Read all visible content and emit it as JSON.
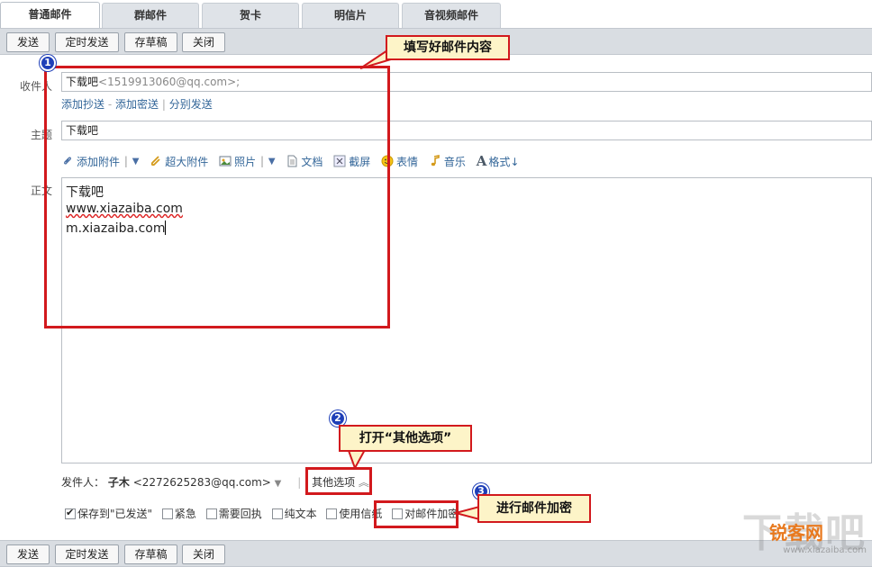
{
  "tabs": [
    "普通邮件",
    "群邮件",
    "贺卡",
    "明信片",
    "音视频邮件"
  ],
  "toolbar": {
    "send": "发送",
    "scheduled": "定时发送",
    "draft": "存草稿",
    "close": "关闭"
  },
  "form": {
    "to_label": "收件人",
    "to_name": "下载吧",
    "to_email": "<1519913060@qq.com>;",
    "cc": "添加抄送",
    "sep1": "-",
    "bcc": "添加密送",
    "sep2": "|",
    "separate": "分别发送",
    "subject_label": "主题",
    "subject": "下载吧",
    "body_label": "正文"
  },
  "attach": {
    "attachment": "添加附件",
    "big_attachment": "超大附件",
    "photo": "照片",
    "document": "文档",
    "screenshot": "截屏",
    "emoji": "表情",
    "music": "音乐",
    "format": "格式↓"
  },
  "body_lines": [
    "下载吧",
    "www.xiazaiba.com",
    "m.xiazaiba.com"
  ],
  "sender": {
    "label": "发件人：",
    "name": "子木",
    "email": "<2272625283@qq.com>",
    "other_options": "其他选项"
  },
  "options": [
    {
      "label": "保存到\"已发送\"",
      "checked": true
    },
    {
      "label": "紧急",
      "checked": false
    },
    {
      "label": "需要回执",
      "checked": false
    },
    {
      "label": "纯文本",
      "checked": false
    },
    {
      "label": "使用信纸",
      "checked": false
    },
    {
      "label": "对邮件加密",
      "checked": false
    }
  ],
  "callouts": {
    "c1": "填写好邮件内容",
    "c2": "打开“其他选项”",
    "c3": "进行邮件加密",
    "n1": "1",
    "n2": "2",
    "n3": "3"
  },
  "watermark": {
    "big": "下载吧",
    "brand": "锐客网",
    "url": "www.xiazaiba.com"
  },
  "colors": {
    "annotation_red": "#d2191d",
    "badge_blue": "#1e3fb8",
    "link": "#336699"
  }
}
